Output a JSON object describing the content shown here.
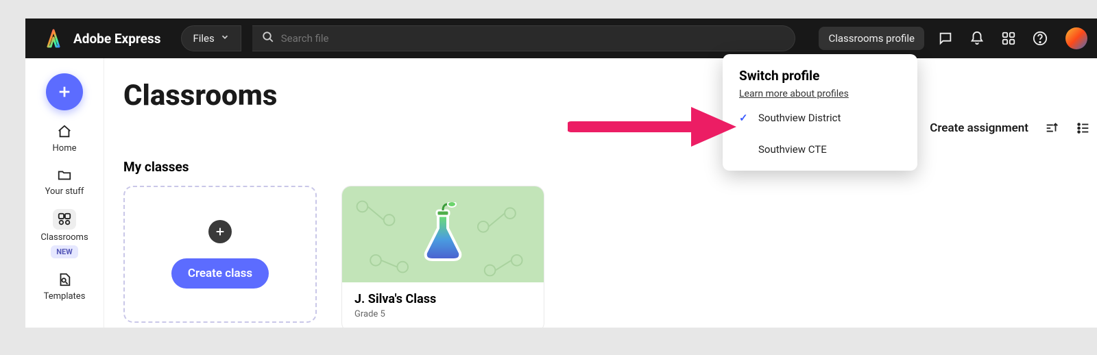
{
  "brand": "Adobe Express",
  "topbar": {
    "files_label": "Files",
    "search_placeholder": "Search file",
    "profile_button": "Classrooms profile"
  },
  "sidebar": {
    "home": "Home",
    "your_stuff": "Your stuff",
    "classrooms": "Classrooms",
    "new_badge": "NEW",
    "templates": "Templates"
  },
  "page": {
    "title": "Classrooms",
    "section": "My classes",
    "create_assignment": "Create assignment",
    "create_class": "Create class"
  },
  "class_card": {
    "title": "J. Silva's Class",
    "subtitle": "Grade 5"
  },
  "dropdown": {
    "heading": "Switch profile",
    "learn": "Learn more about profiles",
    "items": [
      {
        "label": "Southview District",
        "selected": true
      },
      {
        "label": "Southview CTE",
        "selected": false
      }
    ]
  }
}
